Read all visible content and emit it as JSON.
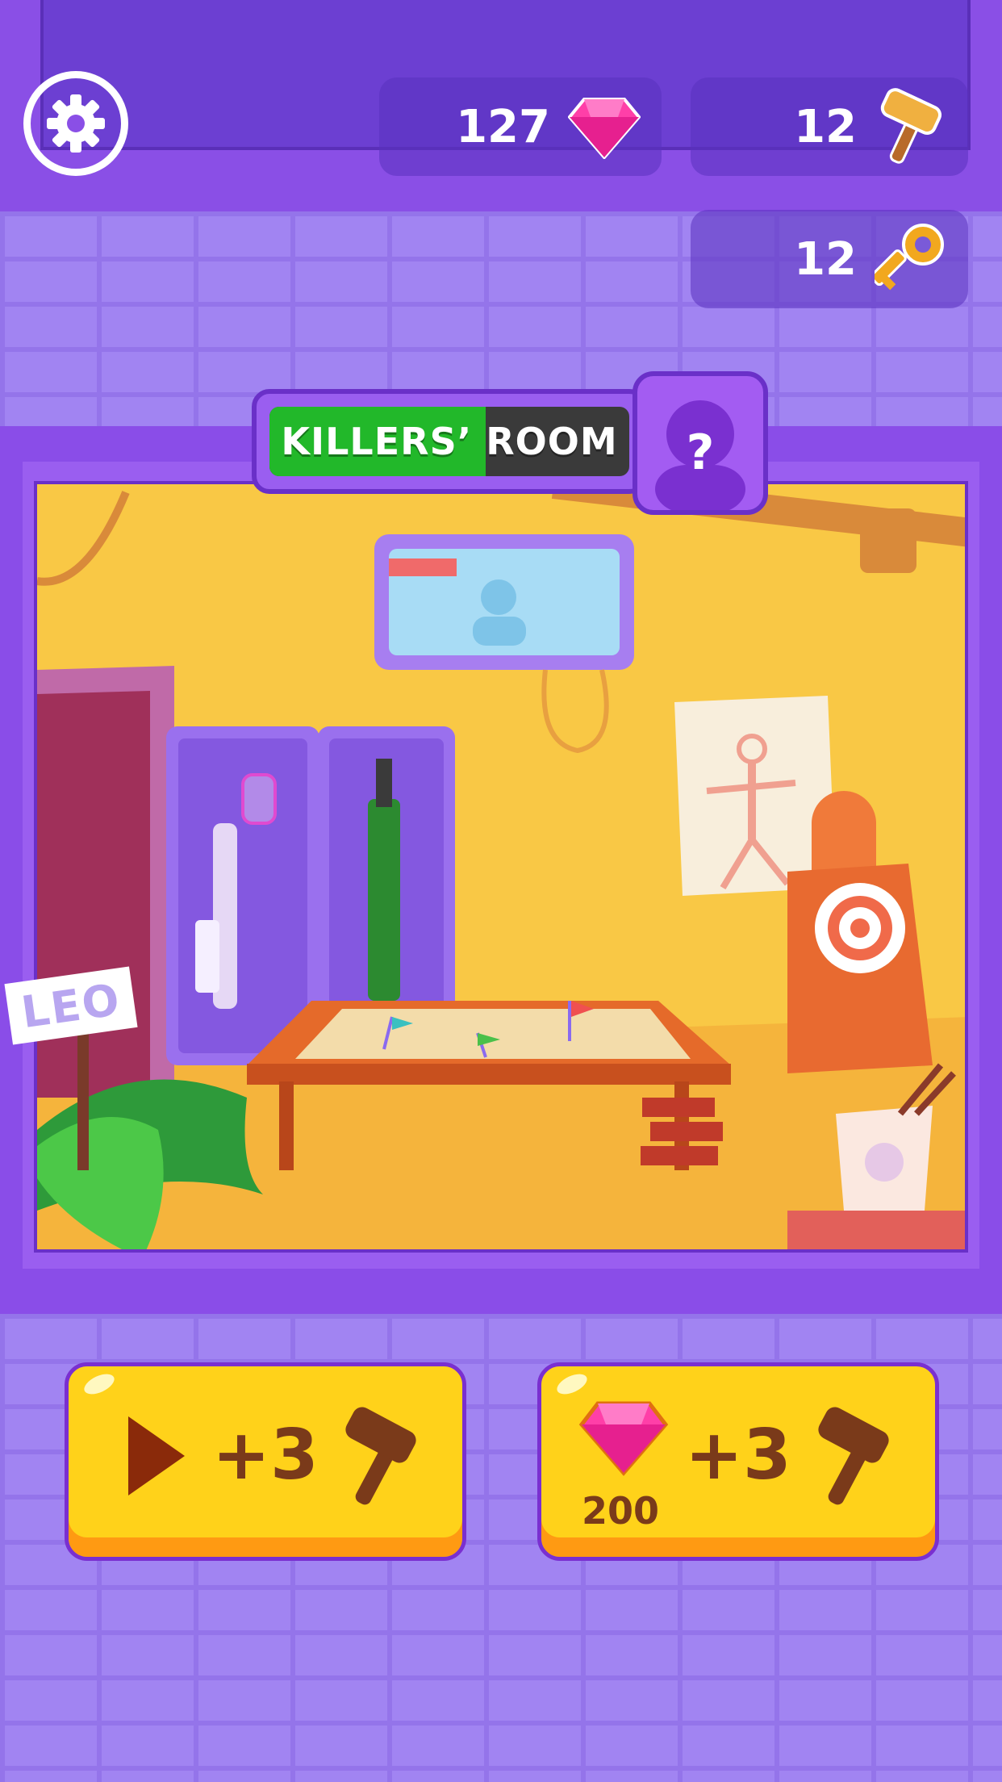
{
  "hud": {
    "gems": "127",
    "hammers": "12",
    "keys": "12"
  },
  "room": {
    "title": "KILLERS’ ROOM",
    "progress": 0.6,
    "mystery_symbol": "?",
    "sign_text": "LEO"
  },
  "actions": [
    {
      "id": "watch-ad",
      "icon": "play-icon",
      "amount": "+3",
      "reward_icon": "hammer-icon"
    },
    {
      "id": "buy-gems",
      "icon": "gem-icon",
      "cost": "200",
      "amount": "+3",
      "reward_icon": "hammer-icon"
    }
  ],
  "colors": {
    "gem": "#ff3fa8",
    "hammer": "#e8a030",
    "key": "#f2a81e",
    "button": "#ffd21a",
    "progress": "#22b82a",
    "frame": "#8a4de8"
  }
}
